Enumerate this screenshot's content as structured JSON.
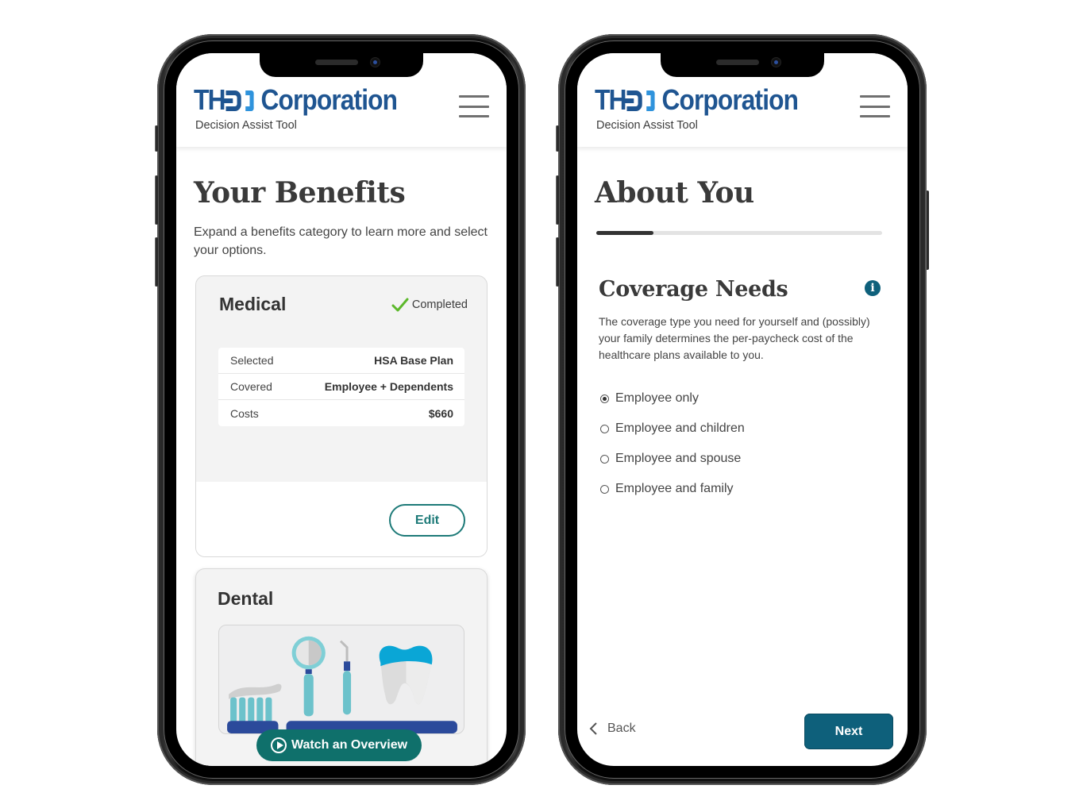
{
  "screens": [
    {
      "header": {
        "logo_prefix": "TH",
        "logo_name": "Corporation",
        "tagline": "Decision Assist Tool",
        "menu_icon": "hamburger-menu-icon"
      },
      "title": "Your Benefits",
      "intro": "Expand a benefits category to learn more and select your options.",
      "cards": [
        {
          "title": "Medical",
          "status": {
            "icon": "checkmark-icon",
            "label": "Completed",
            "color": "#5cb82b"
          },
          "summary": [
            {
              "key": "Selected",
              "value": "HSA Base Plan"
            },
            {
              "key": "Covered",
              "value": "Employee + Dependents"
            },
            {
              "key": "Costs",
              "value": "$660"
            }
          ],
          "action_label": "Edit"
        },
        {
          "title": "Dental",
          "image": "dental-tools-illustration",
          "action_label": "Watch an Overview",
          "action_icon": "play-circle-icon"
        }
      ]
    },
    {
      "header": {
        "logo_prefix": "TH",
        "logo_name": "Corporation",
        "tagline": "Decision Assist Tool",
        "menu_icon": "hamburger-menu-icon"
      },
      "title": "About You",
      "progress": {
        "percent": 20
      },
      "section": {
        "title": "Coverage Needs",
        "info_icon": "info-icon",
        "description": "The coverage type you need for yourself and (possibly) your family determines the per-paycheck cost of the healthcare plans available to you."
      },
      "options": [
        {
          "label": "Employee only",
          "selected": true
        },
        {
          "label": "Employee and children",
          "selected": false
        },
        {
          "label": "Employee and spouse",
          "selected": false
        },
        {
          "label": "Employee and family",
          "selected": false
        }
      ],
      "back_label": "Back",
      "next_label": "Next"
    }
  ],
  "colors": {
    "brand_blue": "#1f5591",
    "brand_light_blue": "#2f93dc",
    "teal": "#0f706b",
    "next_blue": "#0e607b",
    "check_green": "#5cb82b"
  }
}
